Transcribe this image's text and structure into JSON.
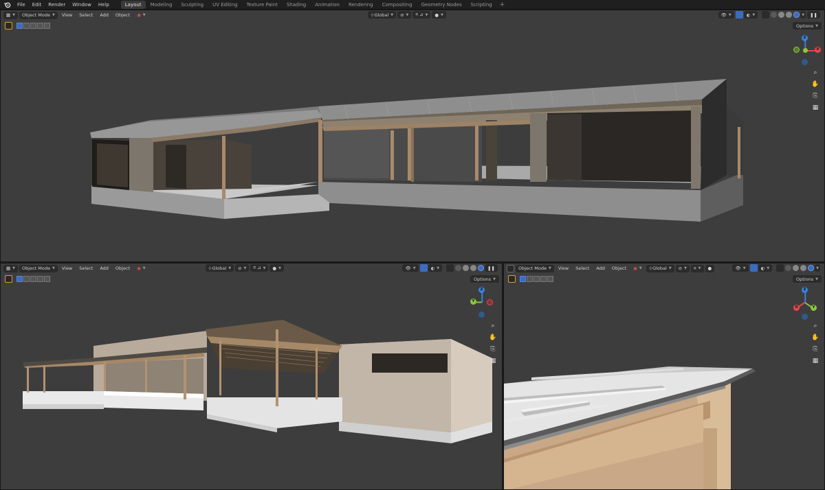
{
  "menu": {
    "items": [
      "File",
      "Edit",
      "Render",
      "Window",
      "Help"
    ]
  },
  "workspaces": {
    "tabs": [
      "Layout",
      "Modeling",
      "Sculpting",
      "UV Editing",
      "Texture Paint",
      "Shading",
      "Animation",
      "Rendering",
      "Compositing",
      "Geometry Nodes",
      "Scripting"
    ],
    "active": "Layout",
    "add_label": "+"
  },
  "viewport_header": {
    "mode": "Object Mode",
    "view": "View",
    "select": "Select",
    "add": "Add",
    "object": "Object",
    "orientation": "Global",
    "options": "Options"
  },
  "gizmo": {
    "x": "X",
    "y": "Y",
    "z": "Z",
    "colors": {
      "x": "#e8474f",
      "y": "#8bc53f",
      "z": "#3a82db"
    }
  },
  "icons": {
    "blender_logo": "blender-logo-icon",
    "zoom": "zoom-icon",
    "pan": "hand-icon",
    "camera": "camera-icon",
    "ortho": "grid-perspective-icon"
  },
  "colors": {
    "viewport_bg": "#3d3d3d",
    "accent": "#3b6cc0",
    "header_bg": "#1f1f1f"
  }
}
